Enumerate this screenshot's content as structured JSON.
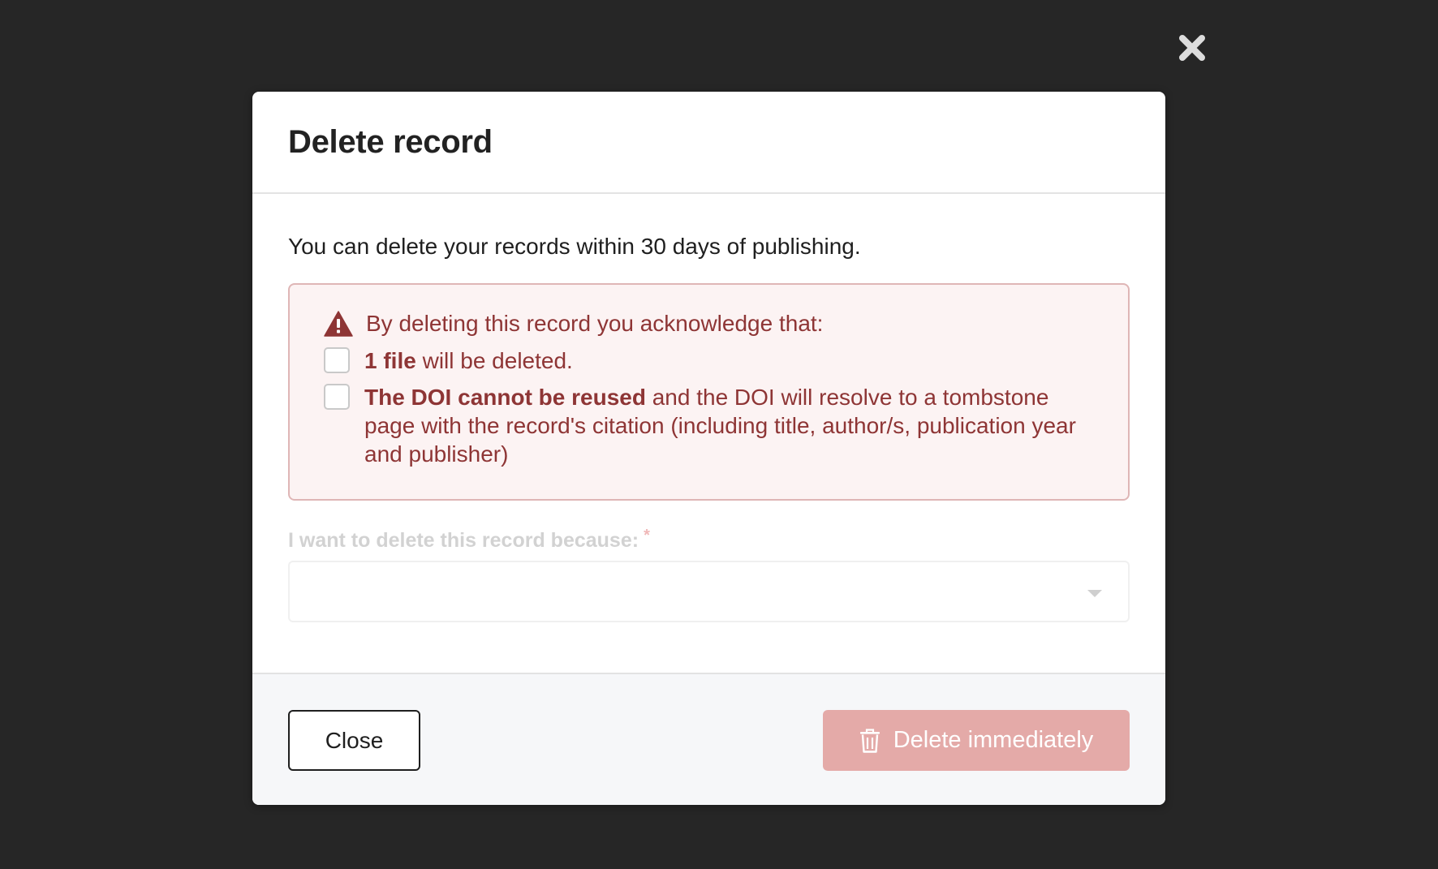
{
  "modal": {
    "title": "Delete record",
    "intro": "You can delete your records within 30 days of publishing.",
    "warning": {
      "heading": "By deleting this record you acknowledge that:",
      "items": [
        {
          "bold": "1 file",
          "text": " will be deleted.",
          "checked": false
        },
        {
          "bold": "The DOI cannot be reused",
          "text": " and the DOI will resolve to a tombstone page with the record's citation (including title, author/s, publication year and publisher)",
          "checked": false
        }
      ]
    },
    "reason_field": {
      "label": "I want to delete this record because:",
      "required_marker": "*",
      "value": ""
    },
    "footer": {
      "close_label": "Close",
      "delete_label": "Delete immediately"
    }
  },
  "icons": {
    "overlay_close": "close-x-icon",
    "warning": "warning-triangle-icon",
    "dropdown": "caret-down-icon",
    "delete": "trash-icon"
  },
  "colors": {
    "overlay": "#262626",
    "warning_text": "#8e3535",
    "warning_bg": "#fcf3f3",
    "warning_border": "#dfb6b6",
    "delete_button": "#e4aaa8"
  }
}
